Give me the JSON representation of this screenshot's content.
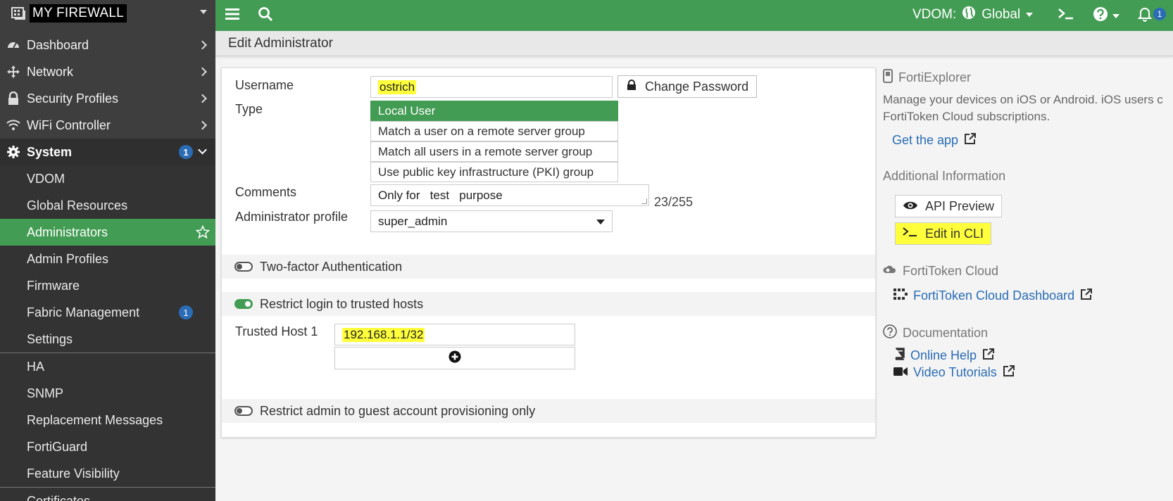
{
  "brand": {
    "name": "MY FIREWALL"
  },
  "sidebar": {
    "items": [
      {
        "label": "Dashboard"
      },
      {
        "label": "Network"
      },
      {
        "label": "Security Profiles"
      },
      {
        "label": "WiFi Controller"
      }
    ],
    "system": {
      "label": "System",
      "badge": "1"
    },
    "system_items": [
      {
        "label": "VDOM"
      },
      {
        "label": "Global Resources"
      },
      {
        "label": "Administrators"
      },
      {
        "label": "Admin Profiles"
      },
      {
        "label": "Firmware"
      },
      {
        "label": "Fabric Management",
        "badge": "1"
      },
      {
        "label": "Settings"
      },
      {
        "label": "HA"
      },
      {
        "label": "SNMP"
      },
      {
        "label": "Replacement Messages"
      },
      {
        "label": "FortiGuard"
      },
      {
        "label": "Feature Visibility"
      },
      {
        "label": "Certificates"
      }
    ]
  },
  "topbar": {
    "vdom_label": "VDOM:",
    "vdom_value": "Global",
    "notif_count": "1"
  },
  "page": {
    "title": "Edit Administrator"
  },
  "form": {
    "username_label": "Username",
    "username_value": "ostrich",
    "change_password": "Change Password",
    "type_label": "Type",
    "type_options": [
      "Local User",
      "Match a user on a remote server group",
      "Match all users in a remote server group",
      "Use public key infrastructure (PKI) group"
    ],
    "comments_label": "Comments",
    "comments_value": "Only for   test   purpose",
    "comments_counter": "23/255",
    "profile_label": "Administrator profile",
    "profile_value": "super_admin",
    "two_factor": "Two-factor Authentication",
    "restrict_hosts": "Restrict login to trusted hosts",
    "trusted_host_label": "Trusted Host 1",
    "trusted_host_value": "192.168.1.1/32",
    "restrict_guest": "Restrict admin to guest account provisioning only"
  },
  "right_panel": {
    "forti_explorer": "FortiExplorer",
    "fe_text_1": "Manage your devices on iOS or Android. iOS users c",
    "fe_text_2": "FortiToken Cloud subscriptions.",
    "get_app": "Get the app",
    "additional_info": "Additional Information",
    "api_preview": "API Preview",
    "edit_cli": "Edit in CLI",
    "fortitoken_cloud": "FortiToken Cloud",
    "ftc_dashboard": "FortiToken Cloud Dashboard",
    "documentation": "Documentation",
    "online_help": "Online Help",
    "video_tutorials": "Video Tutorials"
  },
  "colors": {
    "accent": "#439c54",
    "sidebar": "#3e3e3e",
    "badge": "#2a6cb5",
    "highlight": "#ffff3b"
  }
}
